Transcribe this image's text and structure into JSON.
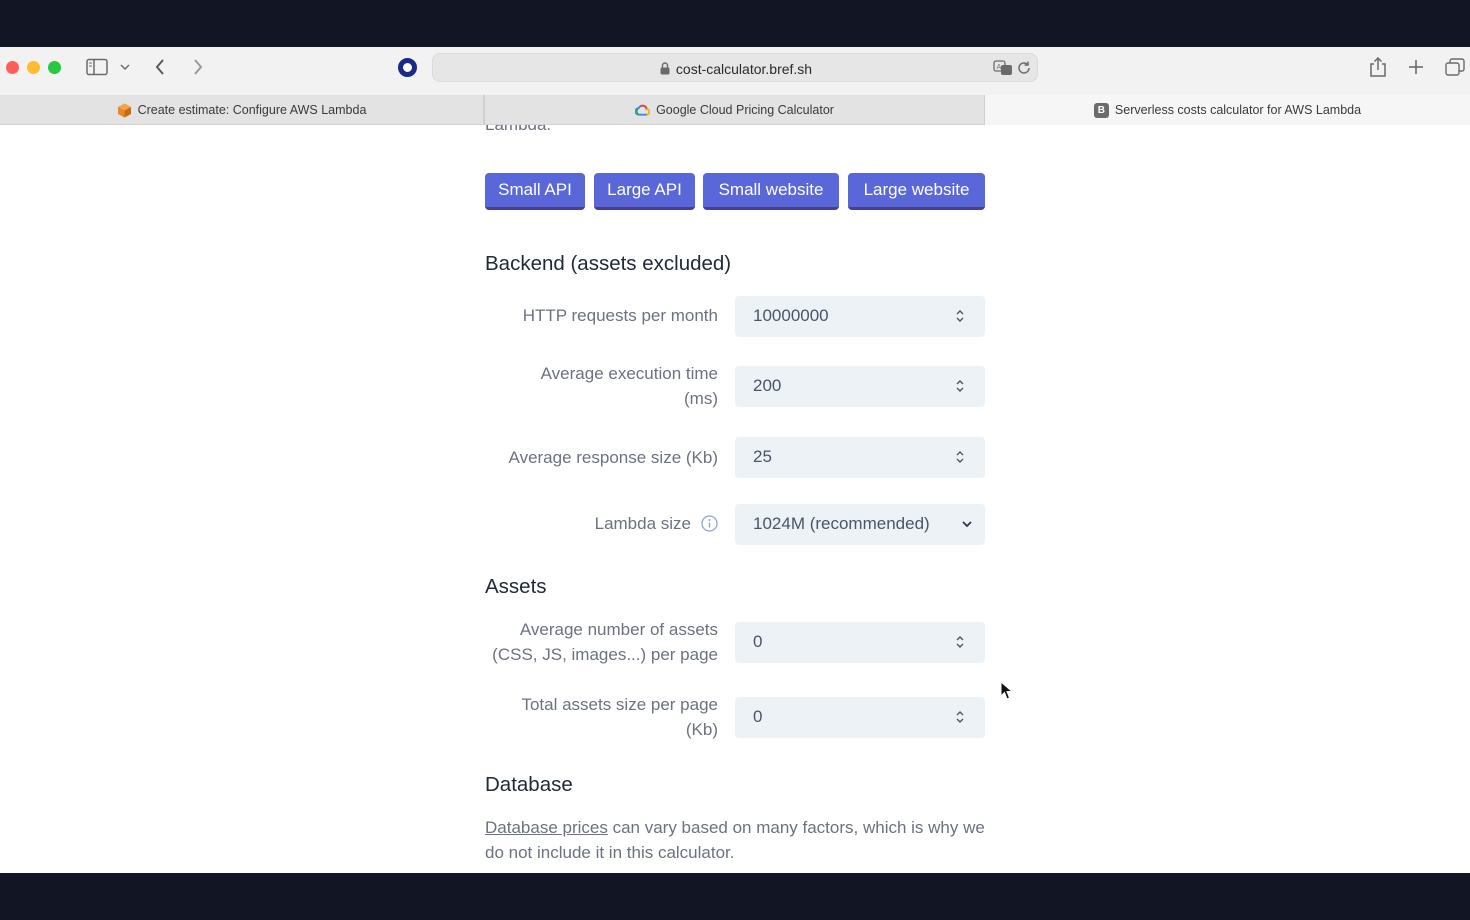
{
  "browser": {
    "url": "cost-calculator.bref.sh",
    "tabs": [
      {
        "label": "Create estimate: Configure AWS Lambda",
        "favicon": "aws-cube-icon"
      },
      {
        "label": "Google Cloud Pricing Calculator",
        "favicon": "google-cloud-icon"
      },
      {
        "label": "Serverless costs calculator for AWS Lambda",
        "favicon": "bref-b-icon",
        "favicon_text": "B"
      }
    ]
  },
  "page": {
    "cut_off_text": "Lambda.",
    "presets": [
      "Small API",
      "Large API",
      "Small website",
      "Large website"
    ],
    "backend": {
      "title": "Backend (assets excluded)",
      "http_requests_label": "HTTP requests per month",
      "http_requests_value": "10000000",
      "exec_time_label_1": "Average execution time",
      "exec_time_label_2": "(ms)",
      "exec_time_value": "200",
      "response_size_label": "Average response size (Kb)",
      "response_size_value": "25",
      "lambda_size_label": "Lambda size",
      "lambda_size_value": "1024M (recommended)"
    },
    "assets": {
      "title": "Assets",
      "count_label_1": "Average number of assets",
      "count_label_2": "(CSS, JS, images...) per page",
      "count_value": "0",
      "size_label_1": "Total assets size per page",
      "size_label_2": "(Kb)",
      "size_value": "0"
    },
    "database": {
      "title": "Database",
      "link_text": "Database prices",
      "text_rest": " can vary based on many factors, which is why we do not include it in this calculator."
    }
  },
  "colors": {
    "accent": "#5a67d8",
    "input_bg": "#edf2f7",
    "muted_text": "#6b7280"
  }
}
